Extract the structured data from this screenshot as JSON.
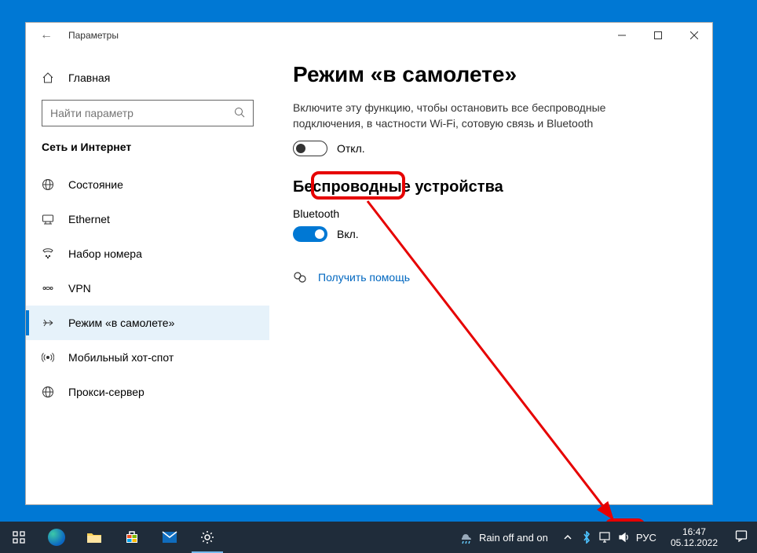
{
  "window": {
    "title": "Параметры",
    "minimize": "−",
    "maximize": "□",
    "close": "✕"
  },
  "sidebar": {
    "home": "Главная",
    "search_placeholder": "Найти параметр",
    "category": "Сеть и Интернет",
    "items": [
      {
        "label": "Состояние",
        "icon": "globe-net-icon"
      },
      {
        "label": "Ethernet",
        "icon": "ethernet-icon"
      },
      {
        "label": "Набор номера",
        "icon": "dialup-icon"
      },
      {
        "label": "VPN",
        "icon": "vpn-icon"
      },
      {
        "label": "Режим «в самолете»",
        "icon": "airplane-icon"
      },
      {
        "label": "Мобильный хот-спот",
        "icon": "hotspot-icon"
      },
      {
        "label": "Прокси-сервер",
        "icon": "proxy-icon"
      }
    ]
  },
  "main": {
    "title": "Режим «в самолете»",
    "description": "Включите эту функцию, чтобы остановить все беспроводные подключения, в частности Wi-Fi, сотовую связь и Bluetooth",
    "airplane_toggle_label": "Откл.",
    "wireless_heading": "Беспроводные устройства",
    "bluetooth_label": "Bluetooth",
    "bluetooth_toggle_label": "Вкл.",
    "help_link": "Получить помощь"
  },
  "taskbar": {
    "weather": "Rain off and on",
    "lang": "РУС",
    "time": "16:47",
    "date": "05.12.2022"
  }
}
